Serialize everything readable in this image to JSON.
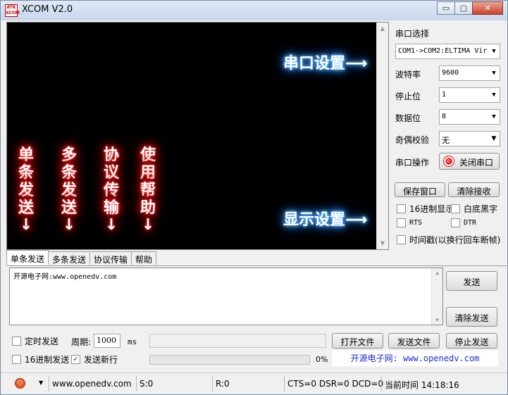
{
  "window": {
    "title": "XCOM V2.0",
    "icon_text": "ATK XCOM",
    "min_glyph": "▭",
    "max_glyph": "▢",
    "close_glyph": "✕"
  },
  "receive": {
    "overlay_serial_settings": "串口设置",
    "overlay_display_settings": "显示设置",
    "arrow_right": "⟶",
    "arrow_down": "↓",
    "vertical_labels": [
      {
        "chars": [
          "单",
          "条",
          "发",
          "送"
        ]
      },
      {
        "chars": [
          "多",
          "条",
          "发",
          "送"
        ]
      },
      {
        "chars": [
          "协",
          "议",
          "传",
          "输"
        ]
      },
      {
        "chars": [
          "使",
          "用",
          "帮",
          "助"
        ]
      }
    ]
  },
  "settings": {
    "port_select_label": "串口选择",
    "port_value": "COM1->COM2:ELTIMA Vir",
    "baud_label": "波特率",
    "baud_value": "9600",
    "stopbit_label": "停止位",
    "stopbit_value": "1",
    "databit_label": "数据位",
    "databit_value": "8",
    "parity_label": "奇偶校验",
    "parity_value": "无",
    "port_op_label": "串口操作",
    "close_port_button": "关闭串口",
    "save_window_button": "保存窗口",
    "clear_receive_button": "清除接收",
    "hex_display_label": "16进制显示",
    "white_bg_label": "白底黑字",
    "rts_label": "RTS",
    "dtr_label": "DTR",
    "timestamp_label": "时间戳(以换行回车断帧)"
  },
  "tabs": [
    "单条发送",
    "多条发送",
    "协议传输",
    "帮助"
  ],
  "send": {
    "text": "开源电子网:www.openedv.com",
    "send_button": "发送",
    "clear_send_button": "清除发送",
    "timed_send_label": "定时发送",
    "period_label": "周期:",
    "period_value": "1000",
    "period_unit": "ms",
    "open_file_button": "打开文件",
    "send_file_button": "发送文件",
    "stop_send_button": "停止发送",
    "hex_send_label": "16进制发送",
    "send_newline_label": "发送新行",
    "send_newline_checked": true,
    "progress_percent": "0%",
    "progress_fraction": 0,
    "website_banner": "开源电子网: www.openedv.com"
  },
  "status": {
    "website": "www.openedv.com",
    "sent": "S:0",
    "received": "R:0",
    "signals": "CTS=0 DSR=0 DCD=0",
    "time": "当前时间 14:18:16"
  }
}
